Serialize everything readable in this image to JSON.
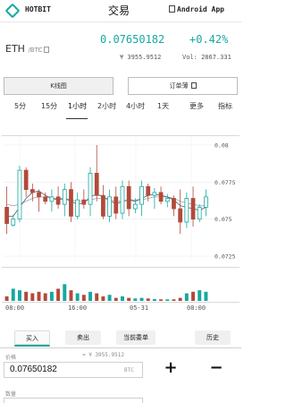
{
  "header": {
    "brand": "HOTBIT",
    "title": "交易",
    "app_label": "Android App"
  },
  "market": {
    "base": "ETH",
    "quote": "/BTC",
    "price": "0.07650182",
    "change": "+0.42%",
    "cny_price": "¥ 3955.9512",
    "volume": "Vol: 2867.331"
  },
  "view_tabs": {
    "kline": "K线图",
    "orderbook": "订单薄"
  },
  "intervals": [
    "5分",
    "15分",
    "1小时",
    "2小时",
    "4小时",
    "1天",
    "更多",
    "指标"
  ],
  "active_interval": "1小时",
  "chart_data": {
    "type": "candlestick",
    "y_ticks": [
      "0.08",
      "0.0775",
      "0.075",
      "0.0725"
    ],
    "ylim": [
      0.0722,
      0.0803
    ],
    "x_ticks": [
      "08:00",
      "16:00",
      "05-31",
      "08:00"
    ],
    "up_color": "#17a8a0",
    "down_color": "#b34a3a",
    "ohlc": [
      [
        0.0758,
        0.0772,
        0.074,
        0.0747
      ],
      [
        0.0746,
        0.0753,
        0.0745,
        0.075
      ],
      [
        0.075,
        0.0786,
        0.0748,
        0.0783
      ],
      [
        0.0783,
        0.0785,
        0.0765,
        0.077
      ],
      [
        0.077,
        0.0774,
        0.0762,
        0.0768
      ],
      [
        0.0768,
        0.077,
        0.0755,
        0.0765
      ],
      [
        0.0765,
        0.0768,
        0.076,
        0.0762
      ],
      [
        0.0762,
        0.077,
        0.0755,
        0.0765
      ],
      [
        0.0765,
        0.0772,
        0.0757,
        0.076
      ],
      [
        0.076,
        0.0774,
        0.0752,
        0.077
      ],
      [
        0.077,
        0.0775,
        0.0748,
        0.0752
      ],
      [
        0.0752,
        0.0768,
        0.075,
        0.0763
      ],
      [
        0.0763,
        0.077,
        0.0757,
        0.076
      ],
      [
        0.076,
        0.0785,
        0.0752,
        0.0781
      ],
      [
        0.0781,
        0.08,
        0.0762,
        0.0766
      ],
      [
        0.0766,
        0.0773,
        0.075,
        0.0752
      ],
      [
        0.0752,
        0.077,
        0.0748,
        0.0765
      ],
      [
        0.0765,
        0.0772,
        0.075,
        0.0754
      ],
      [
        0.0754,
        0.0776,
        0.075,
        0.0772
      ],
      [
        0.0772,
        0.0776,
        0.0752,
        0.0757
      ],
      [
        0.0757,
        0.0764,
        0.0754,
        0.076
      ],
      [
        0.076,
        0.0776,
        0.0752,
        0.0772
      ],
      [
        0.0772,
        0.0774,
        0.0762,
        0.0766
      ],
      [
        0.0766,
        0.0771,
        0.0757,
        0.0768
      ],
      [
        0.0768,
        0.0772,
        0.076,
        0.0762
      ],
      [
        0.0762,
        0.0767,
        0.0758,
        0.0764
      ],
      [
        0.0764,
        0.0766,
        0.0752,
        0.0757
      ],
      [
        0.0757,
        0.077,
        0.074,
        0.0748
      ],
      [
        0.0748,
        0.0768,
        0.0744,
        0.0764
      ],
      [
        0.0764,
        0.0772,
        0.0745,
        0.075
      ],
      [
        0.075,
        0.076,
        0.0748,
        0.0758
      ],
      [
        0.0758,
        0.077,
        0.0752,
        0.0765
      ]
    ],
    "ma_fast": [
      0.0752,
      0.0752,
      0.0758,
      0.0764,
      0.0768,
      0.0769,
      0.0766,
      0.0764,
      0.0763,
      0.0764,
      0.0762,
      0.076,
      0.0761,
      0.0765,
      0.0767,
      0.0765,
      0.0763,
      0.076,
      0.0762,
      0.0763,
      0.0762,
      0.0764,
      0.0766,
      0.0767,
      0.0766,
      0.0765,
      0.0763,
      0.0759,
      0.0758,
      0.0757,
      0.0756,
      0.0758
    ],
    "ma_slow": [
      0.076,
      0.0759,
      0.076,
      0.0762,
      0.0764,
      0.0765,
      0.0765,
      0.0764,
      0.0764,
      0.0764,
      0.0763,
      0.0762,
      0.0762,
      0.0763,
      0.0764,
      0.0764,
      0.0763,
      0.0762,
      0.0762,
      0.0763,
      0.0763,
      0.0763,
      0.0764,
      0.0765,
      0.0765,
      0.0765,
      0.0764,
      0.0762,
      0.0761,
      0.076,
      0.0759,
      0.0759
    ],
    "volume": [
      0.15,
      0.4,
      0.35,
      0.3,
      0.25,
      0.3,
      0.25,
      0.3,
      0.4,
      0.55,
      0.35,
      0.25,
      0.2,
      0.3,
      0.25,
      0.15,
      0.2,
      0.1,
      0.15,
      0.1,
      0.08,
      0.1,
      0.08,
      0.06,
      0.05,
      0.05,
      0.05,
      0.1,
      0.25,
      0.3,
      0.35,
      0.3
    ]
  },
  "trade_tabs": [
    "买入",
    "卖出",
    "当前委单",
    "历史"
  ],
  "order_form": {
    "price_label": "价格",
    "ref_price": "≈ ¥ 3955.9512",
    "price_value": "0.07650182",
    "price_unit": "BTC",
    "plus": "+",
    "minus": "−",
    "amount_label": "数量"
  }
}
